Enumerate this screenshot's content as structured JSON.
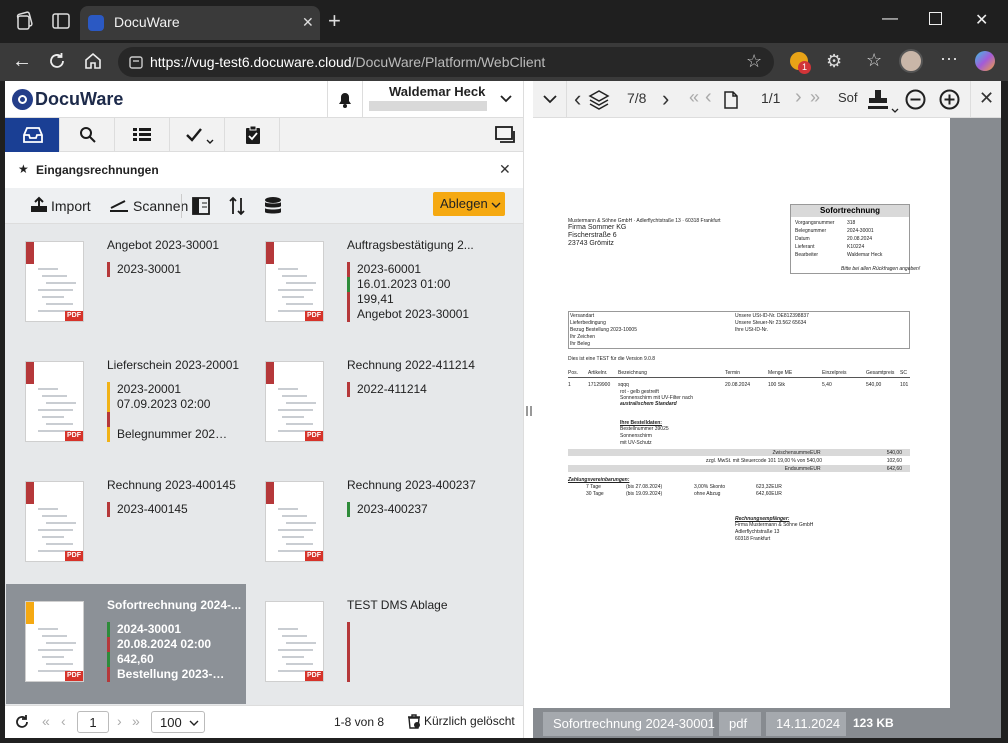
{
  "browser": {
    "tab_title": "DocuWare",
    "url_host": "https://vug-test6.docuware.cloud",
    "url_path": "/DocuWare/Platform/WebClient",
    "badge_count": "1"
  },
  "header": {
    "logo": "DocuWare",
    "user_name": "Waldemar Heck"
  },
  "tray": {
    "title": "Eingangsrechnungen"
  },
  "toolbar": {
    "import_label": "Import",
    "scan_label": "Scannen",
    "store_label": "Ablegen"
  },
  "documents": [
    {
      "title": "Angebot 2023-30001",
      "fields": [
        {
          "text": "2023-30001",
          "color": "#b5383a"
        }
      ],
      "thumb_color": "#b5383a",
      "selected": false
    },
    {
      "title": "Auftragsbestätigung 2...",
      "fields": [
        {
          "text": "2023-60001",
          "color": "#b5383a"
        },
        {
          "text": "16.01.2023 01:00",
          "color": "#2e8b3a"
        },
        {
          "text": "199,41",
          "color": "#b5383a"
        },
        {
          "text": "Angebot 2023-30001",
          "color": "#b5383a"
        }
      ],
      "thumb_color": "#b5383a",
      "selected": false
    },
    {
      "title": "Lieferschein 2023-20001",
      "fields": [
        {
          "text": "2023-20001",
          "color": "#f1b217"
        },
        {
          "text": "07.09.2023 02:00",
          "color": "#f1b217"
        },
        {
          "text": "",
          "color": "#b5383a"
        },
        {
          "text": "Belegnummer 2023-...",
          "color": "#f1b217"
        }
      ],
      "thumb_color": "#b5383a",
      "selected": false
    },
    {
      "title": "Rechnung 2022-411214",
      "fields": [
        {
          "text": "2022-411214",
          "color": "#b5383a"
        }
      ],
      "thumb_color": "#b5383a",
      "selected": false
    },
    {
      "title": "Rechnung 2023-400145",
      "fields": [
        {
          "text": "2023-400145",
          "color": "#b5383a"
        }
      ],
      "thumb_color": "#b5383a",
      "selected": false
    },
    {
      "title": "Rechnung 2023-400237",
      "fields": [
        {
          "text": "2023-400237",
          "color": "#2e8b3a"
        }
      ],
      "thumb_color": "#b5383a",
      "selected": false
    },
    {
      "title": "Sofortrechnung 2024-...",
      "fields": [
        {
          "text": "2024-30001",
          "color": "#2e8b3a"
        },
        {
          "text": "20.08.2024 02:00",
          "color": "#b5383a"
        },
        {
          "text": "642,60",
          "color": "#2e8b3a"
        },
        {
          "text": "Bestellung 2023-100...",
          "color": "#b5383a"
        }
      ],
      "thumb_color": "#f5a912",
      "selected": true
    },
    {
      "title": "TEST DMS Ablage",
      "fields": [
        {
          "text": "",
          "color": "#b5383a"
        },
        {
          "text": "",
          "color": "#b5383a"
        },
        {
          "text": "",
          "color": "#b5383a"
        },
        {
          "text": "",
          "color": "#b5383a"
        }
      ],
      "thumb_color": "",
      "selected": false
    }
  ],
  "pager": {
    "page": "1",
    "page_size": "100",
    "count": "1-8 von 8",
    "deleted_label": "Kürzlich gelöscht"
  },
  "viewer": {
    "doc_pos": "7/8",
    "page_pos": "1/1",
    "partial_label": "Sof",
    "status": {
      "name": "Sofortrechnung 2024-30001",
      "type": "pdf",
      "date": "14.11.2024",
      "size": "123 KB"
    }
  },
  "invoice": {
    "sender_line": "Mustermann & Söhne GmbH · Adlerflychtstraße 13 · 60318 Frankfurt",
    "recipient": [
      "Firma Sommer KG",
      "Fischerstraße 6",
      "23743 Grömitz"
    ],
    "box_title": "Sofortrechnung",
    "box_rows": [
      [
        "Vorgangsnummer",
        "318"
      ],
      [
        "Belegnummer",
        "2024-30001"
      ],
      [
        "Datum",
        "20.08.2024"
      ],
      [
        "Lieferant",
        "K10224"
      ],
      [
        "Bearbeiter",
        "Waldemar Heck"
      ]
    ],
    "box_note": "Bitte bei allen Rückfragen angeben!",
    "info_left": [
      "Versandart",
      "Lieferbedingung",
      "Bezug        Bestellung 2023-10005",
      "Ihr Zeichen",
      "Ihr Beleg"
    ],
    "info_right": [
      "Unsere USt-ID-Nr. DE812398837",
      "Unsere Steuer-Nr 23.562 65634",
      "Ihre USt-ID-Nr."
    ],
    "test_line": "Dies ist eine TEST für die Version 9.0.8",
    "table_headers": [
      "Pos.",
      "Artikelnr.",
      "Bezeichnung",
      "Termin",
      "Menge ME",
      "Einzelpreis",
      "Gesamtpreis",
      "SC"
    ],
    "table_row": [
      "1",
      "17129900",
      "sqqq",
      "20.08.2024",
      "100  Stk",
      "5,40",
      "540,00",
      "101"
    ],
    "desc_lines": [
      "rot - gelb gestreift",
      "Sonnenschirm mit UV-Filter nach",
      "australischem Standard"
    ],
    "order_heading": "Ihre Bestelldaten:",
    "order_lines": [
      "Bestellnummer 39025",
      "Sonnenschirm",
      "mit UV-Schutz"
    ],
    "sum_rows": [
      [
        "Zwischensumme",
        "EUR",
        "540,00"
      ],
      [
        "zzgl. MwSt. mit Steuercode    101    19,00    % von    540,00",
        "",
        "102,60"
      ],
      [
        "Endsumme",
        "EUR",
        "642,60"
      ]
    ],
    "pay_heading": "Zahlungsvereinbarungen:",
    "pay_rows": [
      [
        "7 Tage",
        "(bis 27.08.2024)",
        "3,00% Skonto",
        "623,32EUR"
      ],
      [
        "30 Tage",
        "(bis 19.09.2024)",
        "ohne Abzug",
        "642,60EUR"
      ]
    ],
    "payee_heading": "Rechnungsempfänger:",
    "payee_lines": [
      "Firma Mustermann & Söhne GmbH",
      "Adlerflychtstraße 13",
      "60318 Frankfurt"
    ]
  }
}
